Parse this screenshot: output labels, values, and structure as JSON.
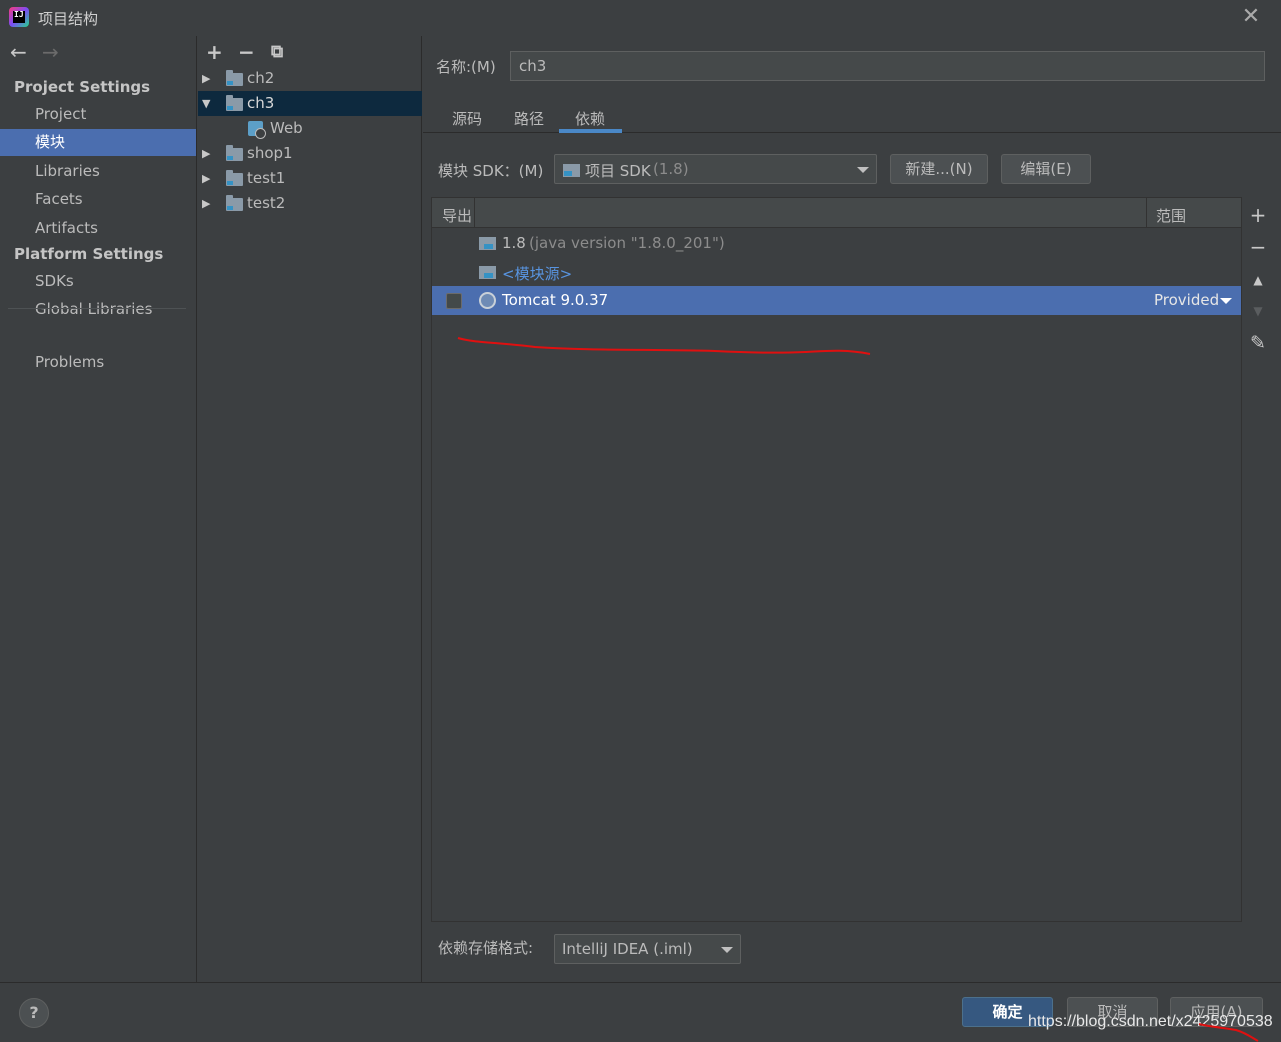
{
  "window": {
    "title": "项目结构",
    "close_glyph": "✕"
  },
  "nav": {
    "back": "←",
    "forward": "→",
    "project_settings_heading": "Project Settings",
    "platform_settings_heading": "Platform Settings",
    "items": [
      {
        "label": "Project",
        "selected": false
      },
      {
        "label": "模块",
        "selected": true
      },
      {
        "label": "Libraries",
        "selected": false
      },
      {
        "label": "Facets",
        "selected": false
      },
      {
        "label": "Artifacts",
        "selected": false
      },
      {
        "label": "SDKs",
        "selected": false
      },
      {
        "label": "Global Libraries",
        "selected": false
      },
      {
        "label": "Problems",
        "selected": false
      }
    ]
  },
  "tree": {
    "tools": {
      "add": "+",
      "remove": "−",
      "copy": "⧉"
    },
    "nodes": [
      {
        "label": "ch2",
        "expanded": false,
        "selected": false
      },
      {
        "label": "ch3",
        "expanded": true,
        "selected": true
      },
      {
        "label": "Web",
        "child": true
      },
      {
        "label": "shop1",
        "expanded": false
      },
      {
        "label": "test1",
        "expanded": false
      },
      {
        "label": "test2",
        "expanded": false
      }
    ]
  },
  "module": {
    "name_label": "名称:(M)",
    "name_value": "ch3",
    "tabs": [
      {
        "label": "源码",
        "active": false
      },
      {
        "label": "路径",
        "active": false
      },
      {
        "label": "依赖",
        "active": true
      }
    ],
    "sdk_label": "模块 SDK：(M)",
    "sdk_value": "项目 SDK",
    "sdk_hint": "(1.8)",
    "new_button": "新建...(N)",
    "edit_button": "编辑(E)",
    "table": {
      "col_export": "导出",
      "col_scope": "范围",
      "rows": [
        {
          "name": "1.8",
          "detail": "(java version \"1.8.0_201\")"
        },
        {
          "name": "<模块源>"
        },
        {
          "name": "Tomcat 9.0.37",
          "scope": "Provided",
          "checked": false,
          "selected": true
        }
      ]
    },
    "side_tools": {
      "add": "+",
      "remove": "−",
      "up": "▲",
      "down": "▼",
      "edit": "✎"
    },
    "storage_label": "依赖存储格式:",
    "storage_value": "IntelliJ IDEA (.iml)"
  },
  "footer": {
    "help": "?",
    "ok": "确定",
    "cancel": "取消",
    "apply": "应用(A)",
    "watermark": "https://blog.csdn.net/x2425970538"
  },
  "colors": {
    "selection": "#4b6eaf",
    "accent_tab": "#4a88c7",
    "annotation_red": "#e01010"
  }
}
